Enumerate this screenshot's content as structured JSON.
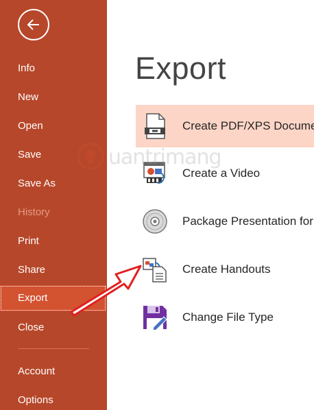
{
  "sidebar": {
    "back_icon": "back-arrow-icon",
    "items": [
      {
        "label": "Info"
      },
      {
        "label": "New"
      },
      {
        "label": "Open"
      },
      {
        "label": "Save"
      },
      {
        "label": "Save As"
      },
      {
        "label": "History",
        "disabled": true
      },
      {
        "label": "Print"
      },
      {
        "label": "Share"
      },
      {
        "label": "Export",
        "selected": true
      },
      {
        "label": "Close"
      },
      {
        "label": "Account"
      },
      {
        "label": "Options"
      }
    ]
  },
  "main": {
    "title": "Export",
    "options": [
      {
        "label": "Create PDF/XPS Docume",
        "icon": "pdf-document-icon",
        "active": true
      },
      {
        "label": "Create a Video",
        "icon": "video-icon"
      },
      {
        "label": "Package Presentation for",
        "icon": "cd-disc-icon"
      },
      {
        "label": "Create Handouts",
        "icon": "handouts-icon"
      },
      {
        "label": "Change File Type",
        "icon": "floppy-disk-icon"
      }
    ]
  },
  "watermark": {
    "text": "uantrimang"
  },
  "colors": {
    "sidebar": "#b7472a",
    "selected_item": "#d35230",
    "active_option": "#fcd5c6",
    "annotation_arrow": "#e0201f"
  }
}
